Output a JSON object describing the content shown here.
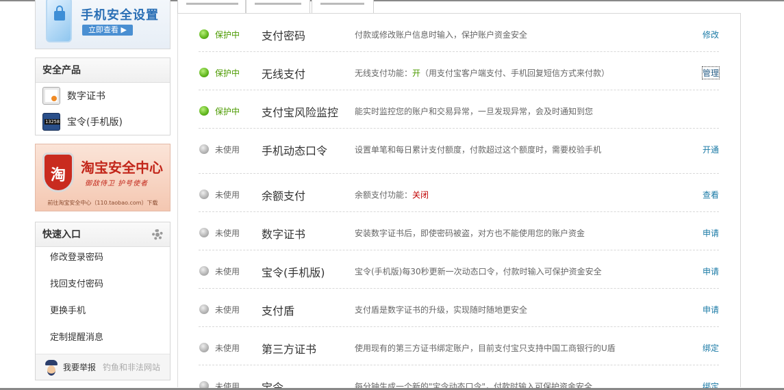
{
  "sidebar": {
    "phone_banner": {
      "title": "手机安全设置",
      "button": "立即查看 ▶"
    },
    "products": {
      "title": "安全产品",
      "items": [
        {
          "label": "数字证书",
          "icon": "certificate-icon"
        },
        {
          "label": "宝令(手机版)",
          "icon": "token-icon"
        }
      ]
    },
    "taobao_banner": {
      "shield_char": "淘",
      "title": "淘宝安全中心",
      "subtitle": "御敌侍卫  护号使者",
      "footer": "前往淘宝安全中心（110.taobao.com）下载"
    },
    "quick": {
      "title": "快速入口",
      "items": [
        {
          "label": "修改登录密码"
        },
        {
          "label": "找回支付密码"
        },
        {
          "label": "更换手机"
        },
        {
          "label": "定制提醒消息"
        }
      ],
      "report_label": "我要举报",
      "report_sub": "钓鱼和非法网站"
    }
  },
  "colors": {
    "protect_green": "#4c9a00",
    "link_teal": "#1a7aa6",
    "off_red": "#c00000"
  },
  "rows": [
    {
      "status": "保护中",
      "name": "支付密码",
      "desc": "付款或修改账户信息时输入，保护账户资金安全",
      "action": "修改"
    },
    {
      "status": "保护中",
      "name": "无线支付",
      "desc_pre": "无线支付功能：",
      "desc_val": "开",
      "desc_post": "（用支付宝客户端支付、手机回复短信方式来付款）",
      "action": "管理"
    },
    {
      "status": "保护中",
      "name": "支付宝风险监控",
      "desc": "能实时监控您的账户和交易异常，一旦发现异常，会及时通知到您",
      "action": ""
    },
    {
      "status": "未使用",
      "name": "手机动态口令",
      "desc": "设置单笔和每日累计支付额度，付款超过这个额度时，需要校验手机",
      "action": "开通"
    },
    {
      "status": "未使用",
      "name": "余额支付",
      "desc_pre": "余额支付功能：",
      "desc_val": "关闭",
      "action": "查看"
    },
    {
      "status": "未使用",
      "name": "数字证书",
      "desc": "安装数字证书后，即使密码被盗，对方也不能使用您的账户资金",
      "action": "申请"
    },
    {
      "status": "未使用",
      "name": "宝令(手机版)",
      "desc": "宝令(手机版)每30秒更新一次动态口令，付款时输入可保护资金安全",
      "action": "申请"
    },
    {
      "status": "未使用",
      "name": "支付盾",
      "desc": "支付盾是数字证书的升级，实现随时随地更安全",
      "action": "申请"
    },
    {
      "status": "未使用",
      "name": "第三方证书",
      "desc": "使用现有的第三方证书绑定账户，目前支付宝只支持中国工商银行的U盾",
      "action": "绑定"
    },
    {
      "status": "未使用",
      "name": "宝令",
      "desc": "每分钟生成一个新的\"宝令动态口令\"，付款时输入可保护资金安全",
      "action": "绑定"
    }
  ]
}
